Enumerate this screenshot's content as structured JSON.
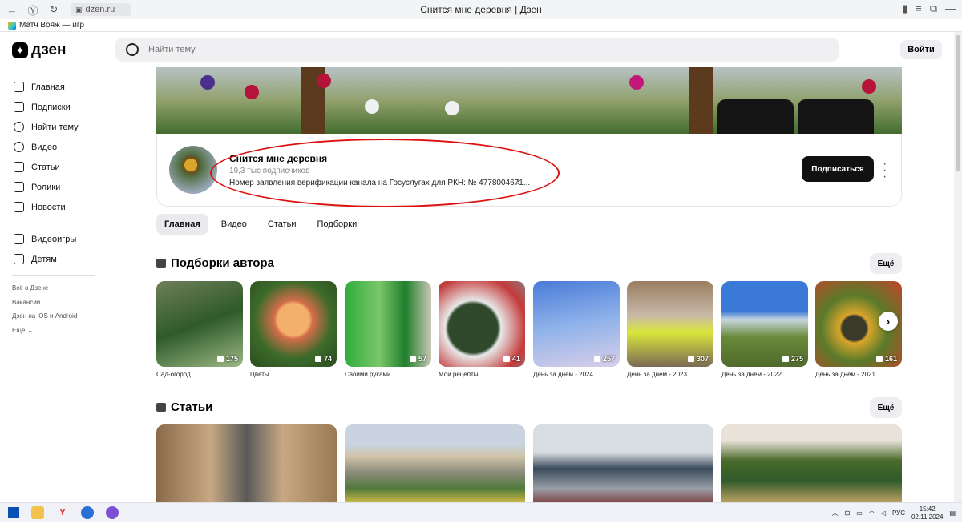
{
  "browser": {
    "url": "dzen.ru",
    "tab_title": "Снится мне деревня | Дзен",
    "bookmark": "Матч Вояж — игр"
  },
  "header": {
    "logo_text": "дзен",
    "search_placeholder": "Найти тему",
    "login_label": "Войти"
  },
  "sidebar": {
    "items": [
      {
        "label": "Главная",
        "icon": "home-icon"
      },
      {
        "label": "Подписки",
        "icon": "subscriptions-icon"
      },
      {
        "label": "Найти тему",
        "icon": "explore-icon"
      },
      {
        "label": "Видео",
        "icon": "video-icon"
      },
      {
        "label": "Статьи",
        "icon": "articles-icon"
      },
      {
        "label": "Ролики",
        "icon": "shorts-icon"
      },
      {
        "label": "Новости",
        "icon": "news-icon"
      }
    ],
    "items2": [
      {
        "label": "Видеоигры",
        "icon": "gamepad-icon"
      },
      {
        "label": "Детям",
        "icon": "kids-icon"
      }
    ],
    "footer_links": [
      "Всё о Дзене",
      "Вакансии",
      "Дзен на iOS и Android",
      "Ещё"
    ]
  },
  "channel": {
    "title": "Снится мне деревня",
    "subscribers": "19,3 тыс подписчиков",
    "description": "Номер заявления верификации канала на Госуслугах для РКН: № 4778004671...",
    "subscribe_label": "Подписаться"
  },
  "tabs": [
    "Главная",
    "Видео",
    "Статьи",
    "Подборки"
  ],
  "collections_section": {
    "title": "Подборки автора",
    "more_label": "Ещё",
    "items": [
      {
        "label": "Сад-огород",
        "count": "175"
      },
      {
        "label": "Цветы",
        "count": "74"
      },
      {
        "label": "Своими руками",
        "count": "57"
      },
      {
        "label": "Мои рецепты",
        "count": "41"
      },
      {
        "label": "День за днём - 2024",
        "count": "257"
      },
      {
        "label": "День за днём - 2023",
        "count": "307"
      },
      {
        "label": "День за днём - 2022",
        "count": "275"
      },
      {
        "label": "День за днём - 2021",
        "count": "161"
      }
    ]
  },
  "articles_section": {
    "title": "Статьи",
    "more_label": "Ещё"
  },
  "taskbar": {
    "language": "РУС",
    "time": "15:42",
    "date": "02.11.2024"
  },
  "colors": {
    "accent_black": "#111111",
    "annotation_red": "#dd1111"
  }
}
